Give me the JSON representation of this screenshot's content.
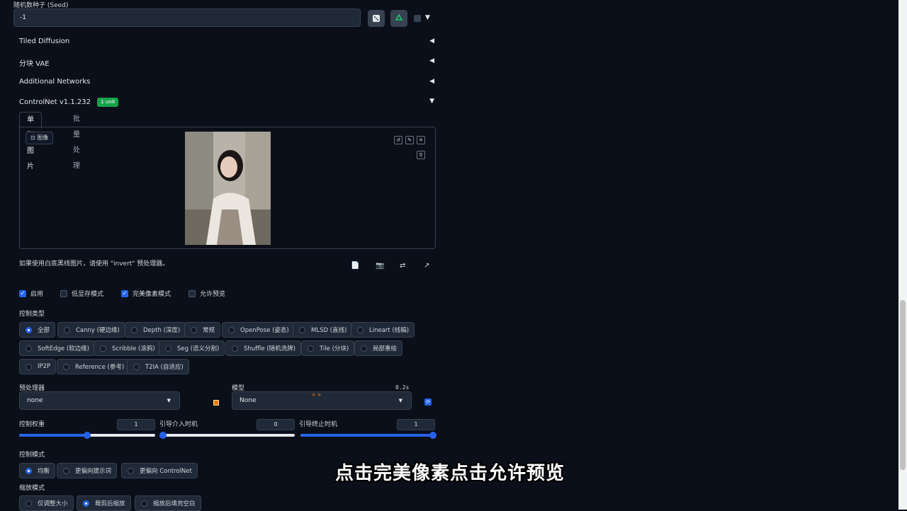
{
  "seed": {
    "label": "随机数种子 (Seed)",
    "value": "-1",
    "dice_icon": "dice-icon",
    "recycle_icon": "recycle-icon",
    "extra_toggle": "▼"
  },
  "accordions": [
    {
      "label": "Tiled Diffusion",
      "arrow": "◀"
    },
    {
      "label": "分块 VAE",
      "arrow": "◀"
    },
    {
      "label": "Additional Networks",
      "arrow": "◀"
    }
  ],
  "controlnet": {
    "title": "ControlNet v1.1.232",
    "badge": "1 unit",
    "badge_color": "#16a34a",
    "arrow": "▼",
    "tabs": [
      "单张图片",
      "批量处理"
    ],
    "image_label": "图像",
    "image_tools": [
      "↺",
      "✎",
      "✕"
    ],
    "image_tool_extra": "⚲",
    "hint": "如果使用白底黑线图片，请使用 \"invert\" 预处理器。",
    "toolbar_icons": [
      "📄",
      "📷",
      "⇄",
      "↗"
    ],
    "checks": [
      {
        "label": "启用",
        "checked": true
      },
      {
        "label": "低显存模式",
        "checked": false
      },
      {
        "label": "完美像素模式",
        "checked": true
      },
      {
        "label": "允许预览",
        "checked": false
      }
    ],
    "control_type": {
      "label": "控制类型",
      "options": [
        {
          "label": "全部",
          "selected": true
        },
        {
          "label": "Canny (硬边缘)",
          "selected": false
        },
        {
          "label": "Depth (深度)",
          "selected": false
        },
        {
          "label": "常规",
          "selected": false
        },
        {
          "label": "OpenPose (姿态)",
          "selected": false
        },
        {
          "label": "MLSD (直线)",
          "selected": false
        },
        {
          "label": "Lineart (线稿)",
          "selected": false
        },
        {
          "label": "SoftEdge (软边缘)",
          "selected": false
        },
        {
          "label": "Scribble (涂鸦)",
          "selected": false
        },
        {
          "label": "Seg (语义分割)",
          "selected": false
        },
        {
          "label": "Shuffle (随机洗牌)",
          "selected": false
        },
        {
          "label": "Tile (分块)",
          "selected": false
        },
        {
          "label": "局部重绘",
          "selected": false
        },
        {
          "label": "IP2P",
          "selected": false
        },
        {
          "label": "Reference (参考)",
          "selected": false
        },
        {
          "label": "T2IA (自适应)",
          "selected": false
        }
      ]
    },
    "preprocessor": {
      "label": "预处理器",
      "value": "none",
      "caret": "▼"
    },
    "model": {
      "label": "模型",
      "value": "None",
      "caret": "▼",
      "timing": "0.2s"
    },
    "sliders": [
      {
        "label": "控制权重",
        "value": "1",
        "fraction": 0.5
      },
      {
        "label": "引导介入时机",
        "value": "0",
        "fraction": 0.0
      },
      {
        "label": "引导终止时机",
        "value": "1",
        "fraction": 1.0
      }
    ],
    "control_mode": {
      "label": "控制模式",
      "options": [
        {
          "label": "均衡",
          "selected": true
        },
        {
          "label": "更偏向提示词",
          "selected": false
        },
        {
          "label": "更偏向 ControlNet",
          "selected": false
        }
      ]
    },
    "resize_mode": {
      "label": "缩放模式",
      "options": [
        {
          "label": "仅调整大小",
          "selected": false
        },
        {
          "label": "裁剪后缩放",
          "selected": true
        },
        {
          "label": "缩放后填充空白",
          "selected": false
        }
      ]
    }
  },
  "subtitle": "点击完美像素点击允许预览",
  "colors": {
    "accent": "#2563eb",
    "background": "#0b0f19"
  }
}
